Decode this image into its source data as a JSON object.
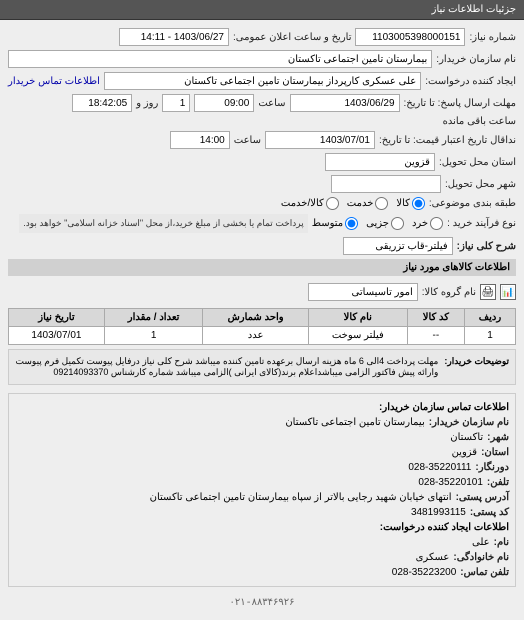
{
  "header": {
    "title": "جزئیات اطلاعات نیاز"
  },
  "form": {
    "request_number_label": "شماره نیاز:",
    "request_number": "1103005398000151",
    "announce_label": "تاریخ و ساعت اعلان عمومی:",
    "announce_value": "1403/06/27 - 14:11",
    "buyer_label": "نام سازمان خریدار:",
    "buyer_value": "بیمارستان تامین اجتماعی تاکستان",
    "creator_label": "ایجاد کننده درخواست:",
    "creator_value": "علی عسکری کارپرداز بیمارستان تامین اجتماعی تاکستان",
    "contact_link": "اطلاعات تماس خریدار",
    "response_deadline_label": "مهلت ارسال پاسخ: تا تاریخ:",
    "response_date": "1403/06/29",
    "saat_label": "ساعت",
    "response_time": "09:00",
    "remain_num": "1",
    "remain_label": "روز و",
    "remain_time": "18:42:05",
    "remain_suffix": "ساعت باقی مانده",
    "valid_label": "نداقال تاریخ اعتبار قیمت: تا تاریخ:",
    "valid_date": "1403/07/01",
    "valid_time": "14:00",
    "place_label": "استان محل تحویل:",
    "place_value": "قزوین",
    "city_label": "شهر محل تحویل:",
    "category_label": "طبقه بندی موضوعی:",
    "cat_options": {
      "kala": "کالا",
      "khedmat": "خدمت",
      "both": "کالا/خدمت"
    },
    "method_label": "نوع فرآیند خرید :",
    "method_options": {
      "low": "خرد",
      "medium": "جزیی",
      "high": "متوسط"
    },
    "payment_note": "پرداخت تمام یا بخشی از مبلغ خرید،از محل \"اسناد خزانه اسلامی\" خواهد بود.",
    "subject_label": "شرح کلی نیاز:",
    "subject_value": "فیلتر-قاب تزریقی"
  },
  "goods_section": "اطلاعات کالاهای مورد نیاز",
  "goods_label": "نام گروه کالا:",
  "goods_group": "امور تاسیساتی",
  "table": {
    "headers": [
      "ردیف",
      "کد کالا",
      "نام کالا",
      "واحد شمارش",
      "تعداد / مقدار",
      "تاریخ نیاز"
    ],
    "rows": [
      {
        "num": "1",
        "code": "--",
        "name": "فیلتر سوخت",
        "unit": "عدد",
        "qty": "1",
        "date": "1403/07/01"
      }
    ]
  },
  "desc": {
    "label": "توضیحات خریدار:",
    "text": "مهلت پرداخت 4الی 6 ماه هزینه ارسال برعهده تامین کننده میباشد شرح کلی نیاز درفایل پیوست تکمیل فرم پیوست وارائه پیش فاکتور الزامی میباشداعلام برند(کالای ایرانی )الزامی میباشد شماره کارشناس 09214093370"
  },
  "contact_section": "اطلاعات تماس سازمان خریدار:",
  "contact": {
    "org_label": "نام سازمان خریدار:",
    "org": "بیمارستان تامین اجتماعی تاکستان",
    "city_label": "شهر:",
    "city": "تاکستان",
    "province_label": "استان:",
    "province": "قزوین",
    "fax_label": "دورنگار:",
    "fax": "028-35220111",
    "tel_label": "تلفن:",
    "tel": "028-35220101",
    "address_label": "آدرس پستی:",
    "address": "انتهای خیابان شهید رجایی بالاتر از سپاه بیمارستان تامین اجتماعی تاکستان",
    "postal_label": "کد پستی:",
    "postal": "3481993115",
    "req_creator_label": "اطلاعات ایجاد کننده درخواست:",
    "name_label": "نام:",
    "name": "علی",
    "family_label": "نام خانوادگی:",
    "family": "عسکری",
    "contact_tel_label": "تلفن تماس:",
    "contact_tel": "028-35223200"
  },
  "footer_phone": "۰۲۱-۸۸۳۴۶۹۲۶"
}
